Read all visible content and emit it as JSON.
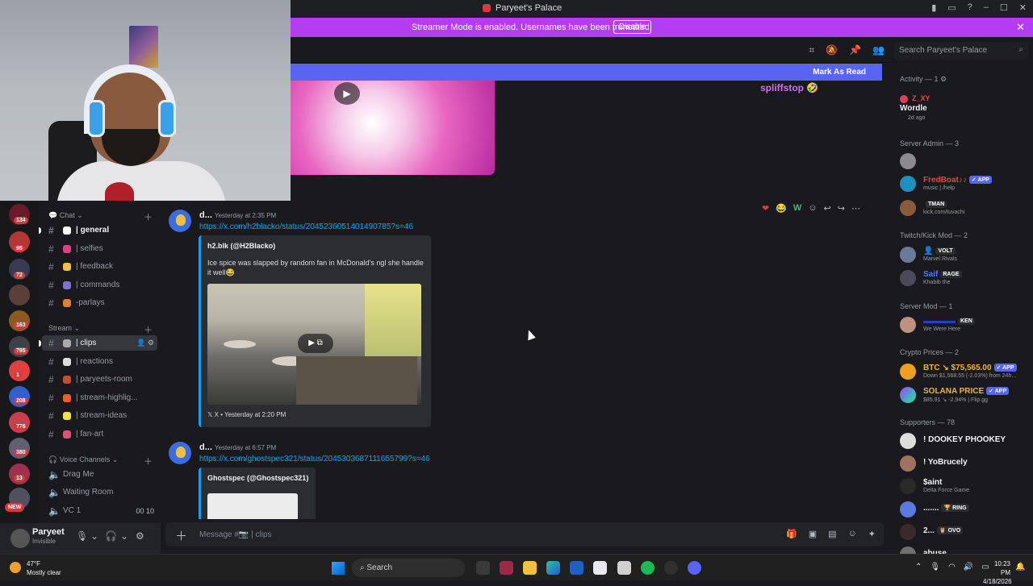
{
  "window": {
    "title": "Paryeet's Palace",
    "controls": [
      "▢",
      "⧉",
      "?",
      "–",
      "☐",
      "✕"
    ]
  },
  "streamer_banner": {
    "message": "Streamer Mode is enabled. Usernames have been truncated.",
    "button": "Disable"
  },
  "search": {
    "placeholder": "Search Paryeet's Palace"
  },
  "mark_as_read": "Mark As Read",
  "top_message": {
    "author": "spliffstop"
  },
  "messages": [
    {
      "author": "d...",
      "time": "Yesterday at 2:35 PM",
      "link": "https://x.com/h2blacko/status/2045236051401490785?s=46",
      "embed": {
        "author": "h2.blk (@H2Blacko)",
        "description": "Ice spice was slapped by random fan in McDonald's ngl she handle it well😂",
        "footer": "X • Yesterday at 2:20 PM"
      },
      "reactions": [
        "❤",
        "😂",
        "W"
      ]
    },
    {
      "author": "d...",
      "time": "Yesterday at 6:57 PM",
      "link": "https://x.com/ghostspec321/status/2045303687111655799?s=46",
      "embed": {
        "author": "Ghostspec (@Ghostspec321)"
      }
    }
  ],
  "chat_input": {
    "placeholder": "Message #📷 | clips"
  },
  "sidebar": {
    "categories": {
      "chat": "Chat",
      "stream": "Stream",
      "voice": "Voice Channels"
    },
    "chat_channels": [
      "| general",
      "| selfies",
      "| feedback",
      "| commands",
      "-parlays"
    ],
    "stream_channels": [
      "| clips",
      "| reactions",
      "| paryeets-room",
      "| stream-highlig...",
      "| stream-ideas",
      "| fan-art"
    ],
    "voice_channels": [
      "Drag Me",
      "Waiting Room",
      "VC 1"
    ],
    "vc1_counts": "00 10"
  },
  "server_badges": [
    "134",
    "95",
    "72",
    "163",
    "795",
    "1",
    "208",
    "776",
    "380",
    "13"
  ],
  "new_badge": "NEW",
  "user": {
    "name": "Paryeet",
    "status": "Invisible"
  },
  "members": {
    "activity_header": "Activity — 1",
    "activity": {
      "name": "Z_XY",
      "game": "Wordle",
      "time": "2d ago"
    },
    "server_admin_header": "Server Admin — 3",
    "server_admin": [
      {
        "name": "",
        "sub": ""
      },
      {
        "name": "FredBoat♪♪",
        "tag": "✓ APP",
        "sub": "music | /help"
      },
      {
        "name": "",
        "tag": "TMAN",
        "sub": "kick.com/tuvachi"
      }
    ],
    "twitch_mod_header": "Twitch/Kick Mod — 2",
    "twitch_mods": [
      {
        "name": "",
        "tag": "VOLT",
        "sub": "Marvel Rivals"
      },
      {
        "name": "Saif",
        "tag": "RAGE",
        "sub": "Khabib the"
      }
    ],
    "server_mod_header": "Server Mod — 1",
    "server_mod": {
      "name": "",
      "tag": "KEN",
      "sub": "We Were Here"
    },
    "crypto_header": "Crypto Prices — 2",
    "crypto": [
      {
        "name": "BTC ↘ $75,565.00",
        "tag": "✓ APP",
        "sub": "Down $1,568.55 (-2.03%) from 24h..."
      },
      {
        "name": "SOLANA PRICE",
        "tag": "✓ APP",
        "sub": "$85.91 ↘ -2.94% | Flip.gg"
      }
    ],
    "supporters_header": "Supporters — 78",
    "supporters": [
      {
        "name": "! DOOKEY PHOOKEY",
        "sub": ""
      },
      {
        "name": "! YoBrucely",
        "sub": ""
      },
      {
        "name": "$aint",
        "sub": "Delta Force Game"
      },
      {
        "name": ".......",
        "tag": "RING",
        "sub": ""
      },
      {
        "name": "2...",
        "tag": "OVO",
        "sub": ""
      },
      {
        "name": "abuse",
        "sub": ""
      }
    ]
  },
  "taskbar": {
    "weather_temp": "47°F",
    "weather_desc": "Mostly clear",
    "search": "Search",
    "time": "10:23 PM",
    "date": "4/18/2026"
  },
  "colors": {
    "blurple": "#5865f2",
    "streamer_banner": "#b43cf3",
    "link": "#00a8fc",
    "admin_red": "#f23f43",
    "mod_blue": "#4e7cf5",
    "crypto_yellow": "#f0b232"
  }
}
